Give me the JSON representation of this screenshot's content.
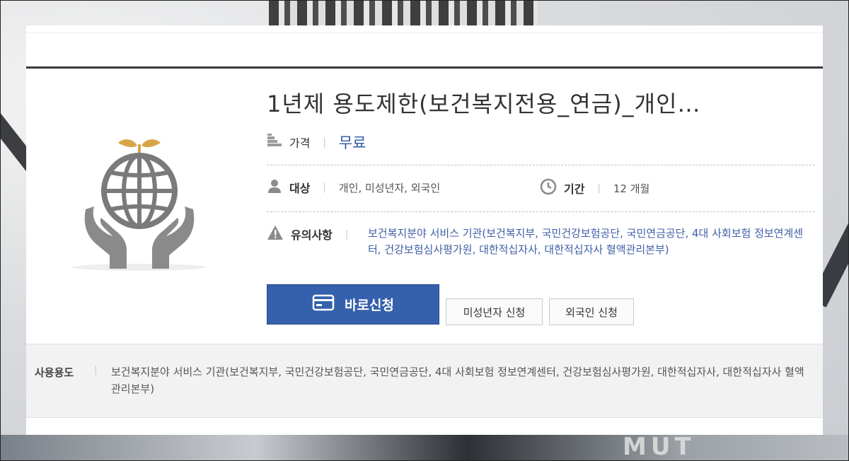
{
  "product": {
    "title": "1년제 용도제한(보건복지전용_연금)_개인…",
    "icon": "globe-in-hands-icon"
  },
  "price": {
    "label": "가격",
    "value": "무료",
    "icon": "coins-icon"
  },
  "target": {
    "label": "대상",
    "value": "개인, 미성년자, 외국인",
    "icon": "person-icon"
  },
  "period": {
    "label": "기간",
    "value": "12 개월",
    "icon": "clock-icon"
  },
  "notice": {
    "label": "유의사항",
    "icon": "warning-icon",
    "text": "보건복지분야 서비스 기관(보건복지부, 국민건강보험공단, 국민연금공단, 4대 사회보험 정보연계센터, 건강보험심사평가원, 대한적십자사, 대한적십자사 혈액관리본부)"
  },
  "actions": {
    "apply": "바로신청",
    "apply_icon": "card-icon",
    "minor_apply": "미성년자 신청",
    "foreigner_apply": "외국인 신청"
  },
  "usage": {
    "label": "사용용도",
    "text": "보건복지분야 서비스 기관(보건복지부, 국민건강보험공단, 국민연금공단, 4대 사회보험 정보연계센터, 건강보험심사평가원, 대한적십자사, 대한적십자사 혈액관리본부)"
  },
  "colors": {
    "accent": "#3560ac",
    "link": "#2e58a6",
    "icon_gray": "#7a7a7a",
    "leaf": "#d7a547"
  }
}
